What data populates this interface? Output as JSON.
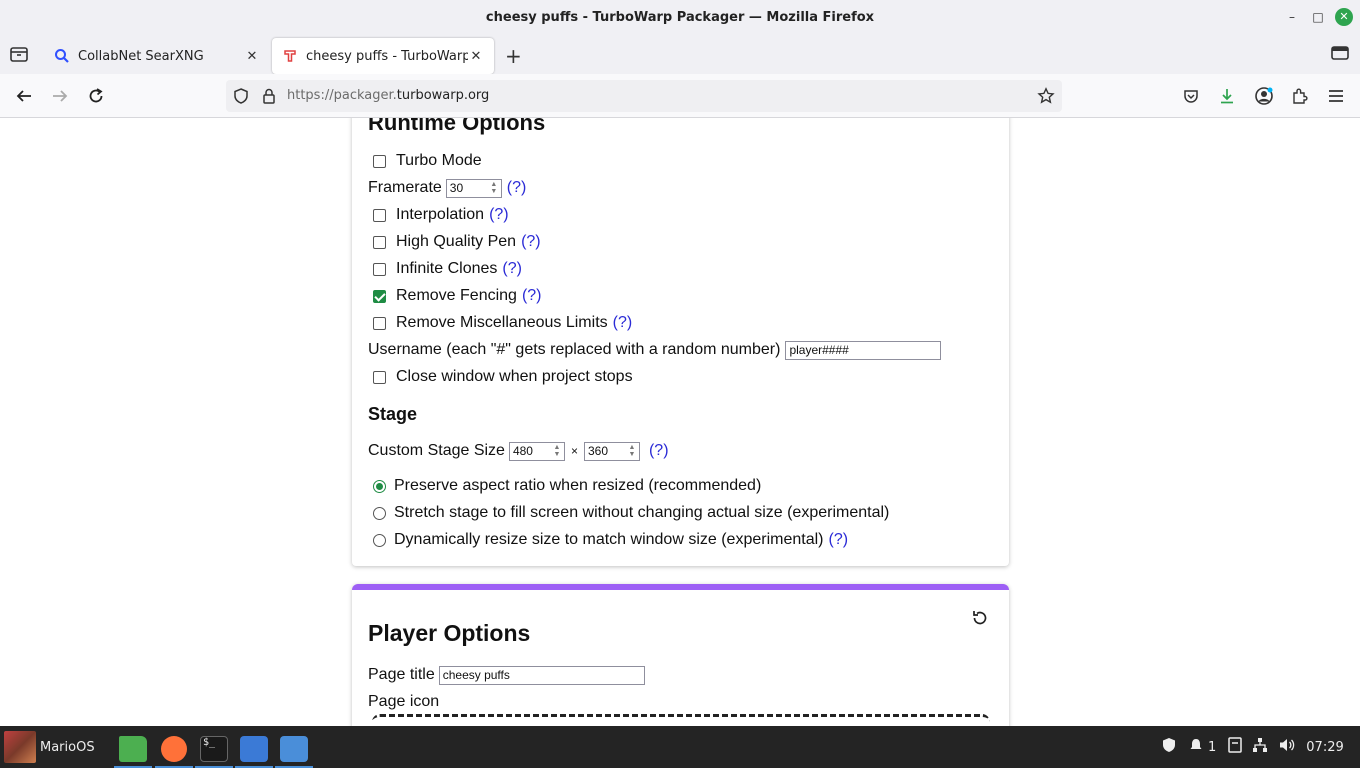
{
  "window": {
    "title": "cheesy puffs - TurboWarp Packager — Mozilla Firefox",
    "minimize": "–",
    "maximize": "□",
    "close": "✕"
  },
  "tabs": [
    {
      "label": "CollabNet SearXNG",
      "close": "✕"
    },
    {
      "label": "cheesy puffs - TurboWarp Pa",
      "close": "✕"
    }
  ],
  "newtab": "+",
  "navbar": {
    "url_prefix": "https://packager.",
    "url_host": "turbowarp.org"
  },
  "runtime": {
    "heading": "Runtime Options",
    "turbo_mode": "Turbo Mode",
    "framerate_label": "Framerate",
    "framerate_value": "30",
    "interpolation": "Interpolation",
    "high_quality_pen": "High Quality Pen",
    "infinite_clones": "Infinite Clones",
    "remove_fencing": "Remove Fencing",
    "remove_misc_limits": "Remove Miscellaneous Limits",
    "username_label": "Username (each \"#\" gets replaced with a random number)",
    "username_value": "player####",
    "close_window": "Close window when project stops",
    "help": "(?)"
  },
  "stage": {
    "heading": "Stage",
    "custom_size_label": "Custom Stage Size",
    "width": "480",
    "height": "360",
    "times": "×",
    "opt_preserve": "Preserve aspect ratio when resized (recommended)",
    "opt_stretch": "Stretch stage to fill screen without changing actual size (experimental)",
    "opt_dynamic": "Dynamically resize size to match window size (experimental)"
  },
  "player": {
    "heading": "Player Options",
    "page_title_label": "Page title",
    "page_title_value": "cheesy puffs",
    "page_icon_label": "Page icon"
  },
  "taskbar": {
    "start_label": "MarioOS",
    "notif_count": "1",
    "clock": "07:29"
  },
  "colors": {
    "accent_purple": "#9d5ff5",
    "check_green": "#1f8c44",
    "help_link": "#2b2bd6"
  }
}
